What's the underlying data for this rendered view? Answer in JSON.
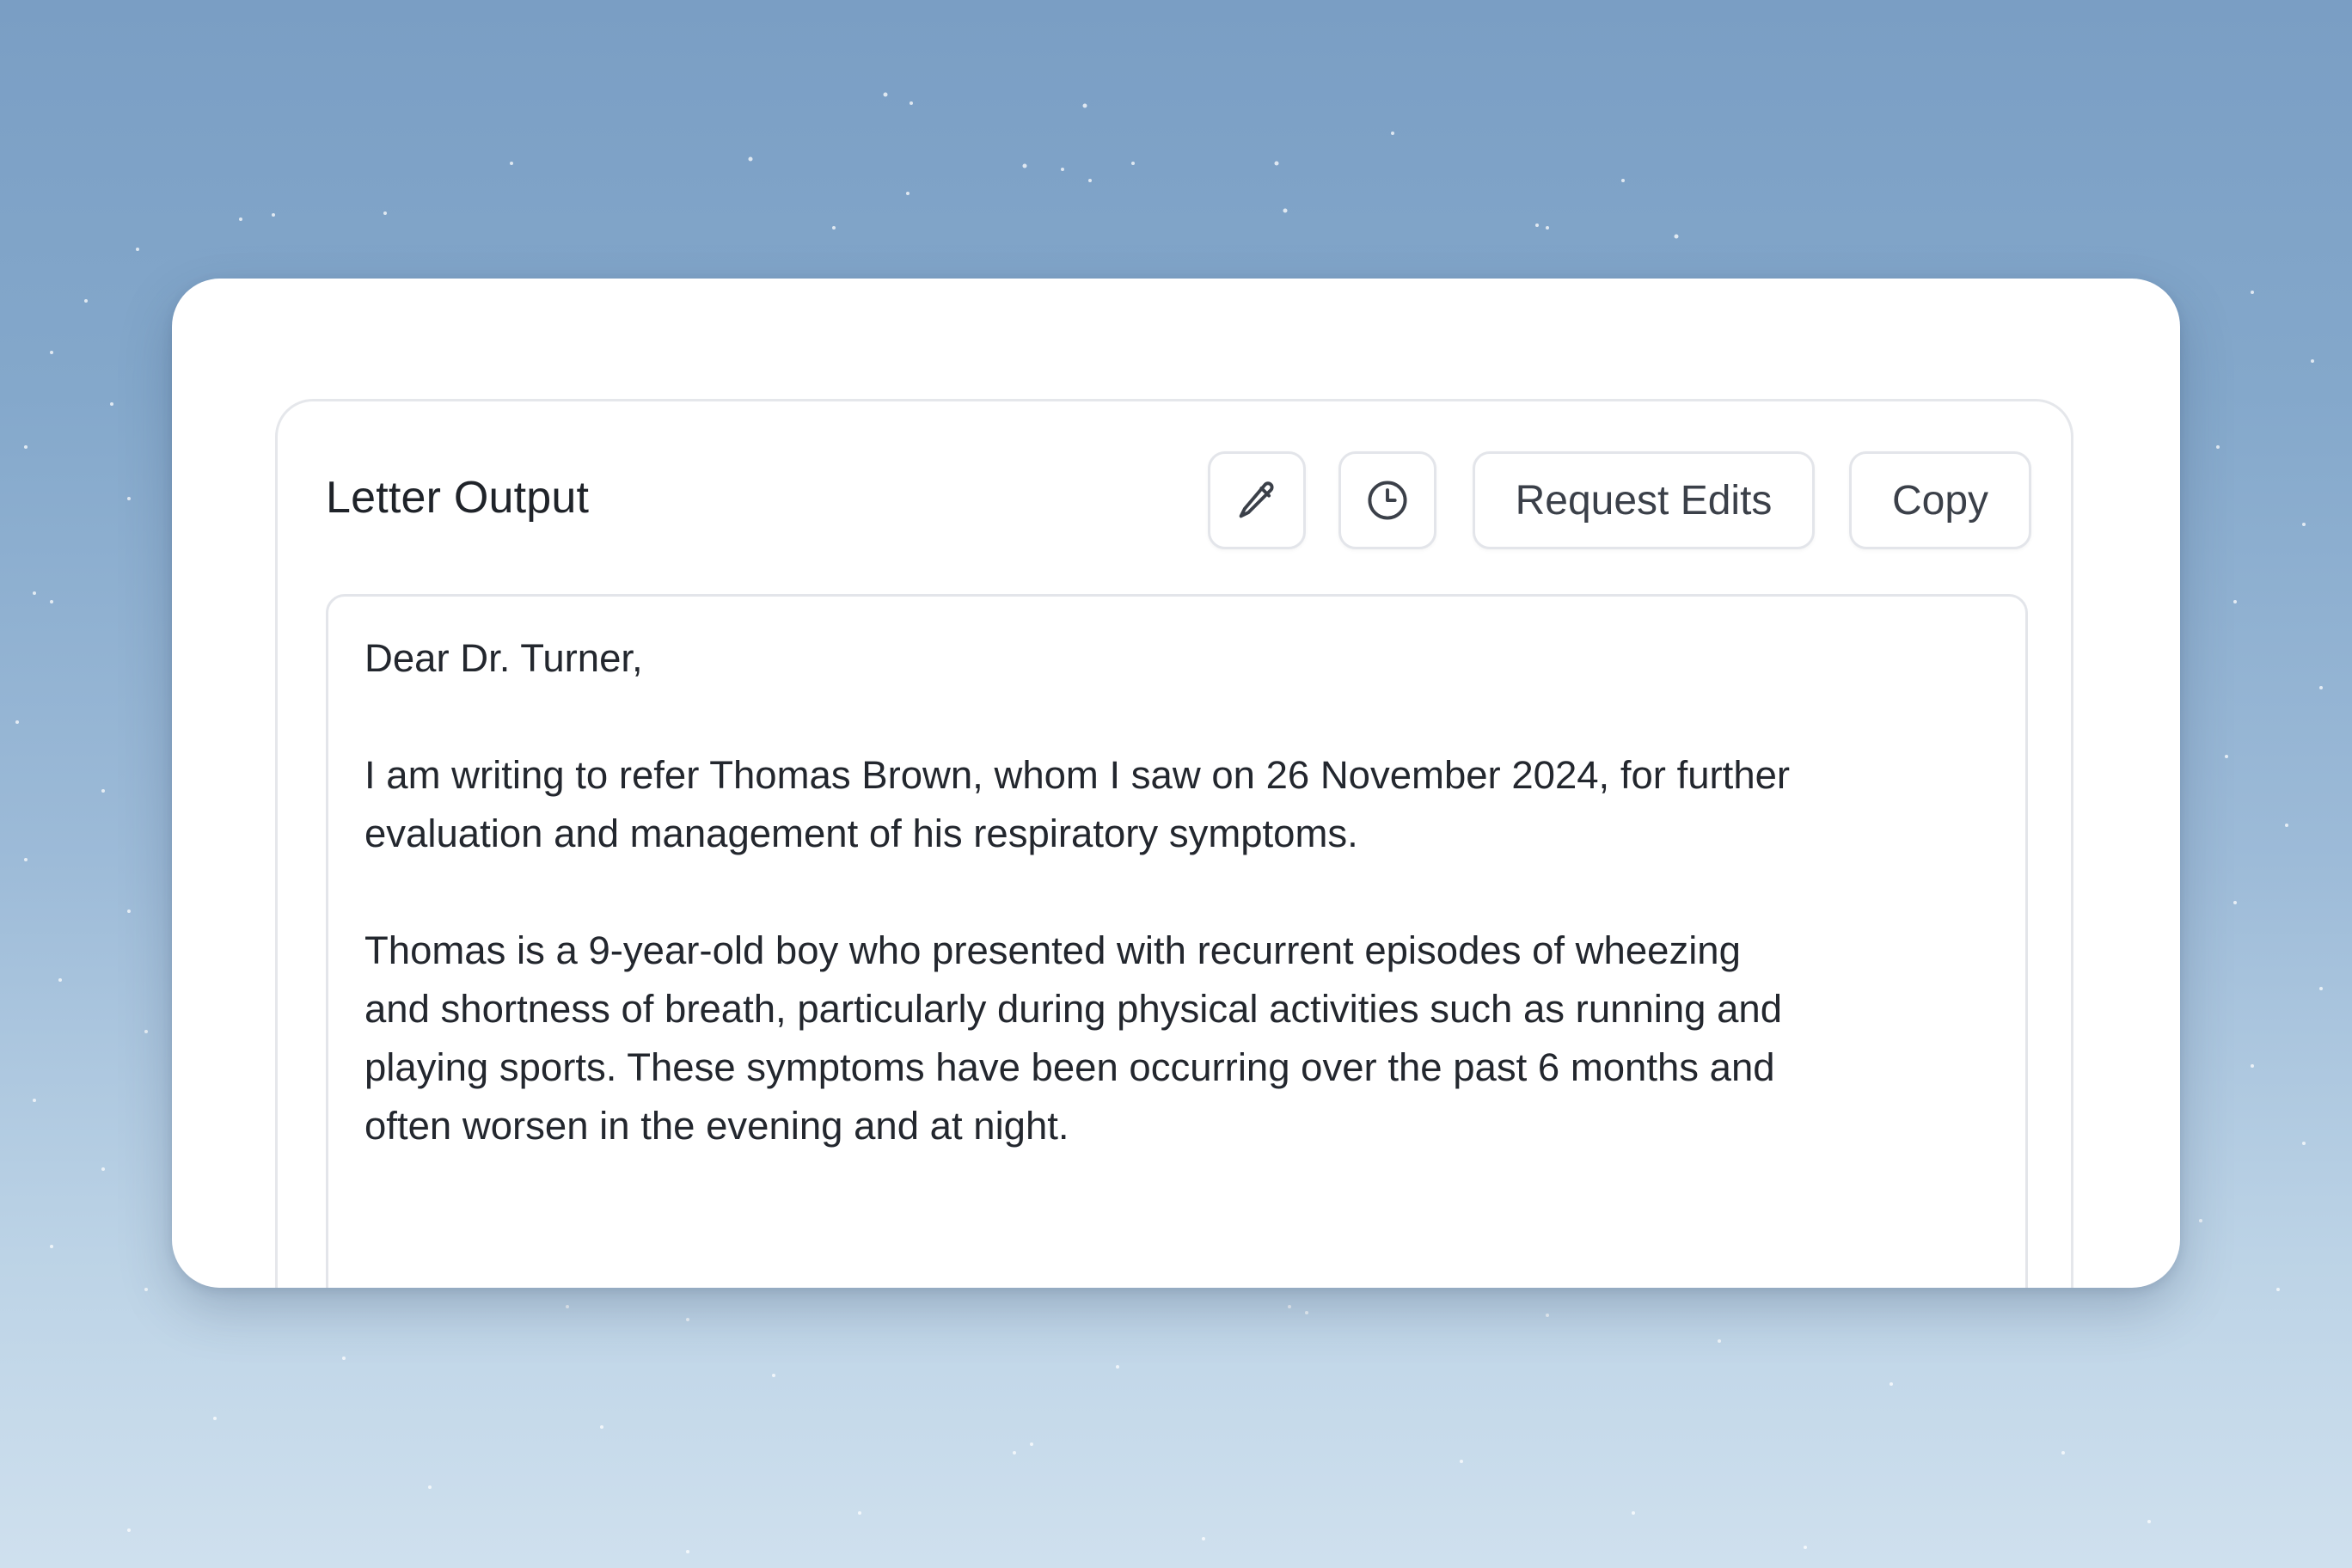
{
  "panel": {
    "title": "Letter Output"
  },
  "toolbar": {
    "edit_icon": "pencil-icon",
    "history_icon": "clock-icon",
    "request_edits_label": "Request Edits",
    "copy_label": "Copy"
  },
  "letter": {
    "salutation": "Dear Dr. Turner,",
    "paragraph_1": [
      "I am writing to refer Thomas Brown, whom I saw on 26 November 2024, for further",
      "evaluation and management of his respiratory symptoms."
    ],
    "paragraph_2": [
      "Thomas is a 9-year-old boy who presented with recurrent episodes of wheezing",
      "and shortness of breath, particularly during physical activities such as running and",
      "playing sports. These symptoms have been occurring over the past 6 months and",
      "often worsen in the evening and at night."
    ]
  },
  "colors": {
    "background_top": "#7a9ec4",
    "background_bottom": "#cfe0ee",
    "card": "#ffffff",
    "border": "#e3e5ea",
    "text": "#23272e"
  }
}
